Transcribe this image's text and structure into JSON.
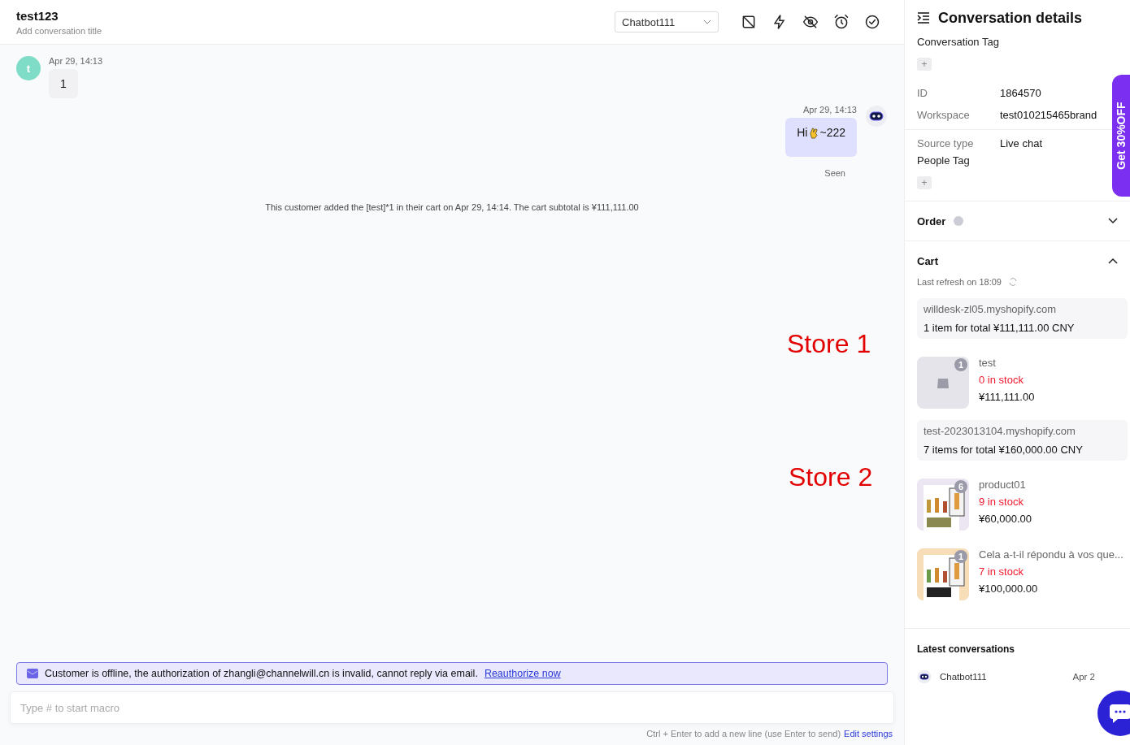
{
  "header": {
    "title": "test123",
    "subtitle": "Add conversation title",
    "assignee": "Chatbot111"
  },
  "messages": [
    {
      "kind": "customer",
      "avatar": "t",
      "time": "Apr 29, 14:13",
      "text": "1"
    },
    {
      "kind": "bot",
      "time": "Apr 29, 14:13",
      "text_before": "Hi",
      "text_after": "~222",
      "status": "Seen"
    },
    {
      "kind": "event",
      "text": "This customer added the [test]*1 in their cart on Apr 29, 14:14. The cart subtotal is ¥111,111.00"
    }
  ],
  "annotations": [
    "Store 1",
    "Store 2"
  ],
  "notice": {
    "text": "Customer is offline, the authorization of zhangli@channelwill.cn is invalid, cannot reply via email.",
    "link": "Reauthorize now"
  },
  "composer": {
    "placeholder": "Type # to start macro",
    "hint": "Ctrl + Enter to add a new line (use Enter to send)",
    "link": "Edit settings"
  },
  "details": {
    "title": "Conversation details",
    "conversation_tag_label": "Conversation Tag",
    "conversation_tag_button": "+",
    "fields": [
      {
        "label": "ID",
        "value": "1864570"
      },
      {
        "label": "Workspace",
        "value": "test010215465brand"
      },
      {
        "label": "Source type",
        "value": "Live chat"
      }
    ],
    "people_tag_label": "People Tag",
    "people_tag_button": "+",
    "sections": [
      {
        "title": "Order",
        "expanded": false
      },
      {
        "title": "Cart",
        "expanded": true
      }
    ],
    "refresh": "Last refresh on 18:09",
    "stores": [
      {
        "domain": "willdesk-zl05.myshopify.com",
        "summary": "1 item for total ¥111,111.00 CNY",
        "items": [
          {
            "kind": "placeholder",
            "qty": "1",
            "name": "test",
            "stock": "0 in stock",
            "price": "¥111,111.00"
          }
        ]
      },
      {
        "domain": "test-2023013104.myshopify.com",
        "summary": "7 items for total ¥160,000.00 CNY",
        "items": [
          {
            "kind": "picture",
            "qty": "6",
            "name": "product01",
            "stock": "9 in stock",
            "price": "¥60,000.00"
          },
          {
            "kind": "picture",
            "qty": "1",
            "name": "Cela a-t-il répondu à vos que...",
            "stock": "7 in stock",
            "price": "¥100,000.00"
          }
        ]
      }
    ],
    "latest_title": "Latest conversations",
    "latest": [
      {
        "name": "Chatbot111",
        "time": "Apr 2"
      }
    ]
  },
  "promo": "Get 30%OFF"
}
